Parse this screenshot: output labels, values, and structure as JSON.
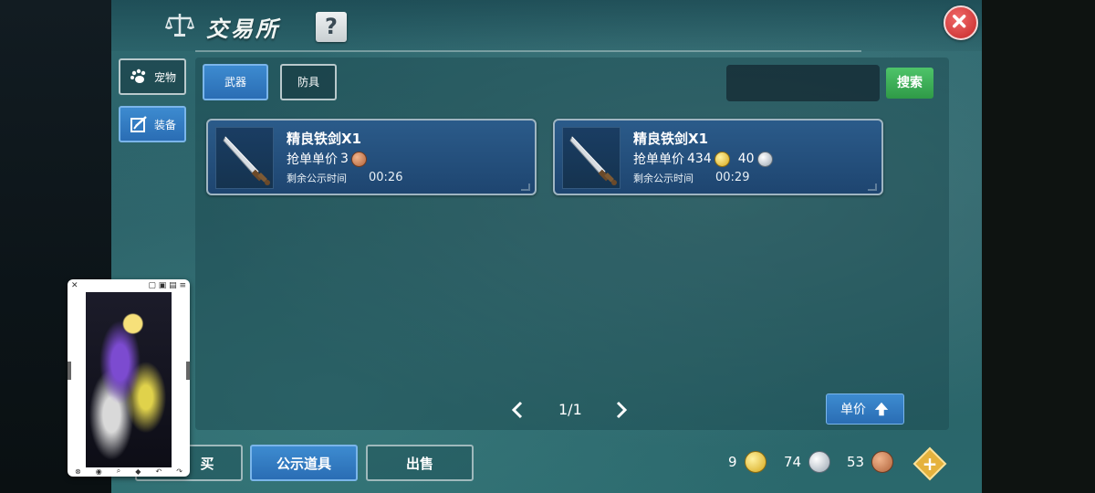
{
  "header": {
    "title": "交易所",
    "help_label": "?",
    "scale_icon": "scale-icon",
    "close_icon": "close-icon"
  },
  "side_tabs": [
    {
      "label": "宠物",
      "icon": "paw-icon",
      "active": false
    },
    {
      "label": "装备",
      "icon": "equipment-icon",
      "active": true
    }
  ],
  "category_tabs": [
    {
      "label": "武器",
      "active": true
    },
    {
      "label": "防具",
      "active": false
    }
  ],
  "search": {
    "placeholder": "",
    "button_label": "搜索"
  },
  "listings": [
    {
      "name": "精良铁剑X1",
      "price_label": "抢单单价",
      "prices": [
        {
          "amount": "3",
          "coin": "copper"
        }
      ],
      "time_label": "剩余公示时间",
      "time_value": "00:26",
      "icon": "sword-icon"
    },
    {
      "name": "精良铁剑X1",
      "price_label": "抢单单价",
      "prices": [
        {
          "amount": "434",
          "coin": "gold"
        },
        {
          "amount": "40",
          "coin": "silver"
        }
      ],
      "time_label": "剩余公示时间",
      "time_value": "00:29",
      "icon": "sword-icon"
    }
  ],
  "pagination": {
    "text": "1/1"
  },
  "sort": {
    "label": "单价",
    "icon": "sort-up-icon"
  },
  "bottom_tabs": [
    {
      "label": "买",
      "active": false
    },
    {
      "label": "公示道具",
      "active": true
    },
    {
      "label": "出售",
      "active": false
    }
  ],
  "currencies": [
    {
      "amount": "9",
      "coin": "gold"
    },
    {
      "amount": "74",
      "coin": "silver"
    },
    {
      "amount": "53",
      "coin": "copper"
    }
  ],
  "add_currency_label": "+",
  "colors": {
    "accent_blue": "#2f7bc4",
    "search_green": "#3aae55",
    "close_red": "#d93a3a",
    "panel_teal": "#2d6a70"
  }
}
